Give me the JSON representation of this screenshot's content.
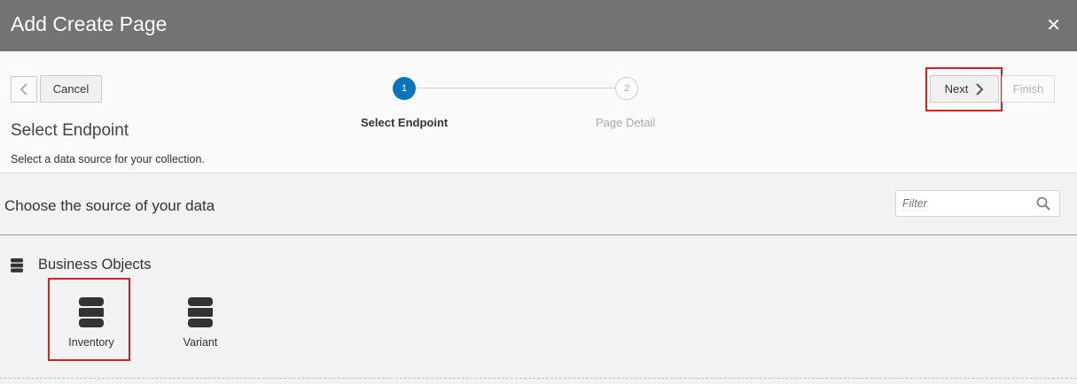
{
  "dialog": {
    "title": "Add Create Page"
  },
  "toolbar": {
    "cancel_label": "Cancel",
    "next_label": "Next",
    "finish_label": "Finish"
  },
  "train": {
    "steps": [
      {
        "number": "1",
        "label": "Select Endpoint",
        "active": true
      },
      {
        "number": "2",
        "label": "Page Detail",
        "active": false
      }
    ]
  },
  "page": {
    "heading": "Select Endpoint",
    "subtitle": "Select a data source for your collection."
  },
  "source": {
    "prompt": "Choose the source of your data",
    "filter_placeholder": "Filter"
  },
  "business_objects": {
    "title": "Business Objects",
    "items": [
      {
        "label": "Inventory",
        "selected": true
      },
      {
        "label": "Variant",
        "selected": false
      }
    ]
  },
  "colors": {
    "titlebar": "#737373",
    "accent": "#0a73bd",
    "highlight": "#d62020"
  }
}
